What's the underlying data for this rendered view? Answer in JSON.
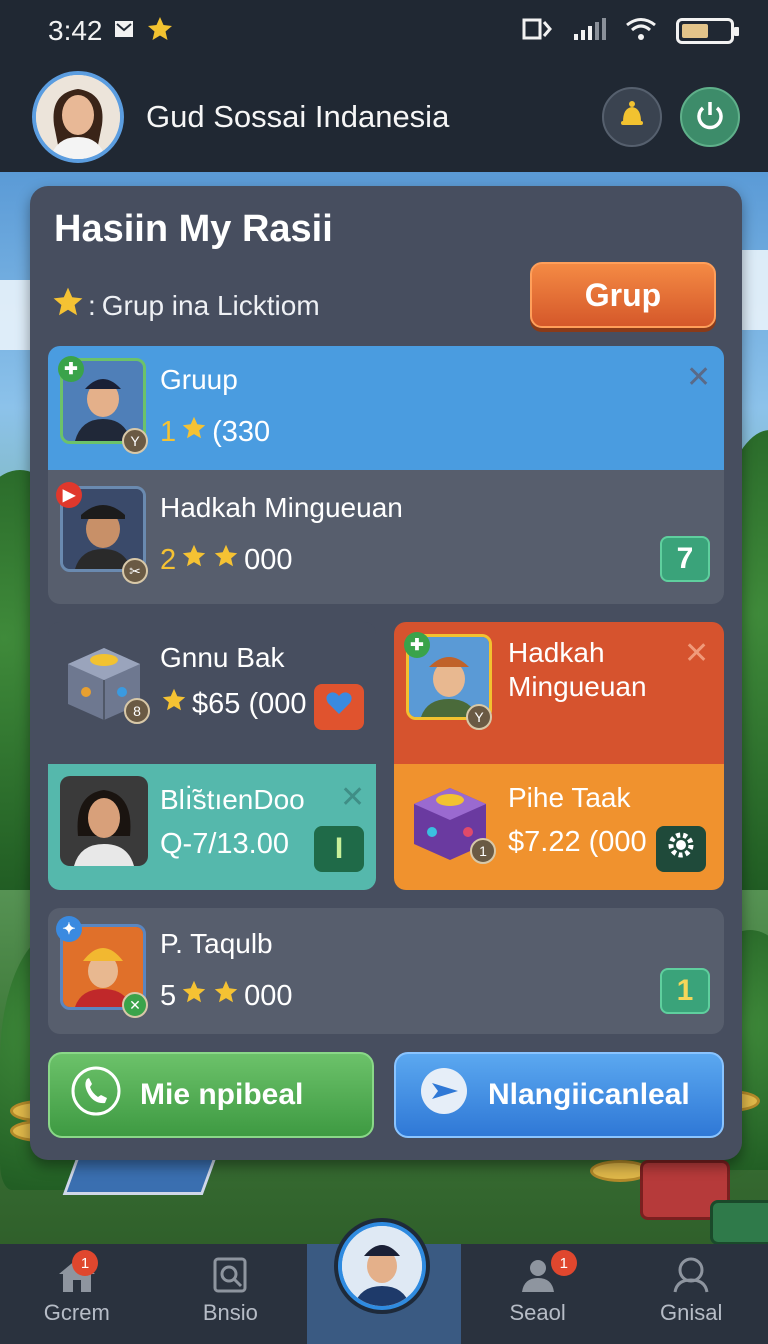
{
  "status_bar": {
    "time": "3:42"
  },
  "header": {
    "username": "Gud Sossai Indanesia"
  },
  "panel": {
    "title": "Hasiin My Rasii",
    "subtitle": "Grup ina Licktiom",
    "grup_button": "Grup"
  },
  "rows": [
    {
      "name": "Gruup",
      "value_prefix": "1",
      "value": "(330",
      "stars": 1,
      "action": "",
      "color": "#4a9ce0"
    },
    {
      "name": "Hadkah Mingueuan",
      "value_prefix": "2",
      "value": "000",
      "stars": 2,
      "action": "7",
      "color": "#545b6a"
    }
  ],
  "tiles": [
    {
      "name": "Gnnu Bak",
      "value": "$65 (000",
      "action": "heart",
      "color": "#474e5f"
    },
    {
      "name": "Hadkah Mingueuan",
      "value": "",
      "action": "close",
      "color": "#d6532e"
    },
    {
      "name": "Blı̇̃stıenDoo",
      "value": "Q-7/13.00",
      "action": "I",
      "color": "#55b8ac"
    },
    {
      "name": "Pihe Taak",
      "value": "$7.22 (000",
      "action": "settings",
      "color": "#f0922e"
    }
  ],
  "wide_row": {
    "name": "P. Taqulb",
    "value_prefix": "5",
    "value": "000",
    "stars": 2,
    "action": "1"
  },
  "actions": {
    "primary": "Mie npibeal",
    "secondary": "Nlangiicanleal"
  },
  "nav": [
    {
      "label": "Gcrem",
      "badge": "1",
      "icon": "home-icon"
    },
    {
      "label": "Bnsio",
      "badge": "",
      "icon": "search-icon"
    },
    {
      "label": "",
      "badge": "",
      "icon": "avatar"
    },
    {
      "label": "Seaol",
      "badge": "1",
      "icon": "user-icon"
    },
    {
      "label": "Gnisal",
      "badge": "",
      "icon": "profile-icon"
    }
  ],
  "colors": {
    "accent_orange": "#e56a35",
    "green": "#4caf50",
    "blue": "#3d8de6",
    "panel": "#474e5f"
  }
}
